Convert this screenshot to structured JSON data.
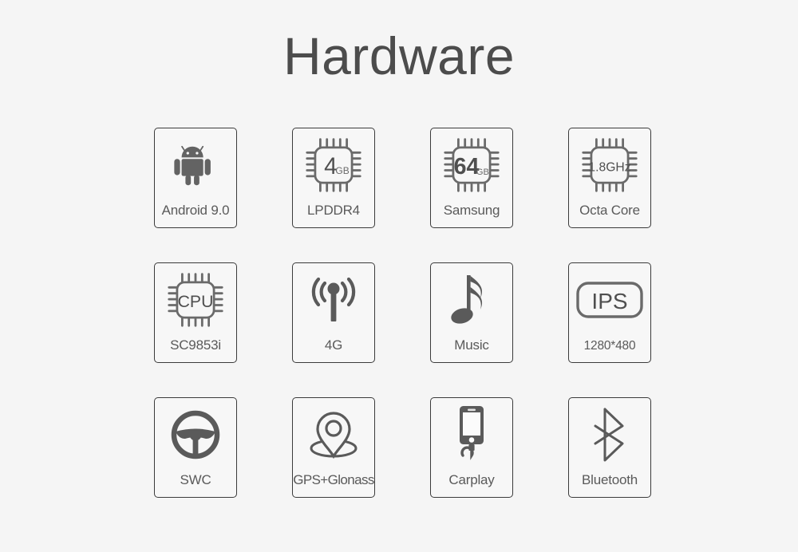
{
  "header": {
    "title": "Hardware"
  },
  "colors": {
    "background": "#f5f5f5",
    "tile_background": "#f7f7f7",
    "tile_border": "#3b3b3b",
    "icon": "#5a5a5a",
    "title_text": "#4c4c4c",
    "label_text": "#5a5a5a"
  },
  "grid": {
    "rows": 3,
    "columns": 4,
    "tiles": [
      {
        "label": "Android 9.0",
        "icon": "android-robot-icon",
        "icon_text": ""
      },
      {
        "label": "LPDDR4",
        "icon": "memory-chip-icon",
        "icon_text": "4",
        "icon_subtext": "GB"
      },
      {
        "label": "Samsung",
        "icon": "memory-chip-icon",
        "icon_text": "64",
        "icon_subtext": "GB"
      },
      {
        "label": "Octa Core",
        "icon": "processor-chip-icon",
        "icon_text": "1.8GHz"
      },
      {
        "label": "SC9853i",
        "icon": "cpu-chip-icon",
        "icon_text": "CPU"
      },
      {
        "label": "4G",
        "icon": "antenna-signal-icon",
        "icon_text": ""
      },
      {
        "label": "Music",
        "icon": "music-note-icon",
        "icon_text": ""
      },
      {
        "label": "1280*480",
        "icon": "ips-screen-icon",
        "icon_text": "IPS"
      },
      {
        "label": "SWC",
        "icon": "steering-wheel-icon",
        "icon_text": ""
      },
      {
        "label": "GPS+Glonass",
        "icon": "map-pin-icon",
        "icon_text": ""
      },
      {
        "label": "Carplay",
        "icon": "phone-cable-icon",
        "icon_text": ""
      },
      {
        "label": "Bluetooth",
        "icon": "bluetooth-icon",
        "icon_text": ""
      }
    ]
  }
}
